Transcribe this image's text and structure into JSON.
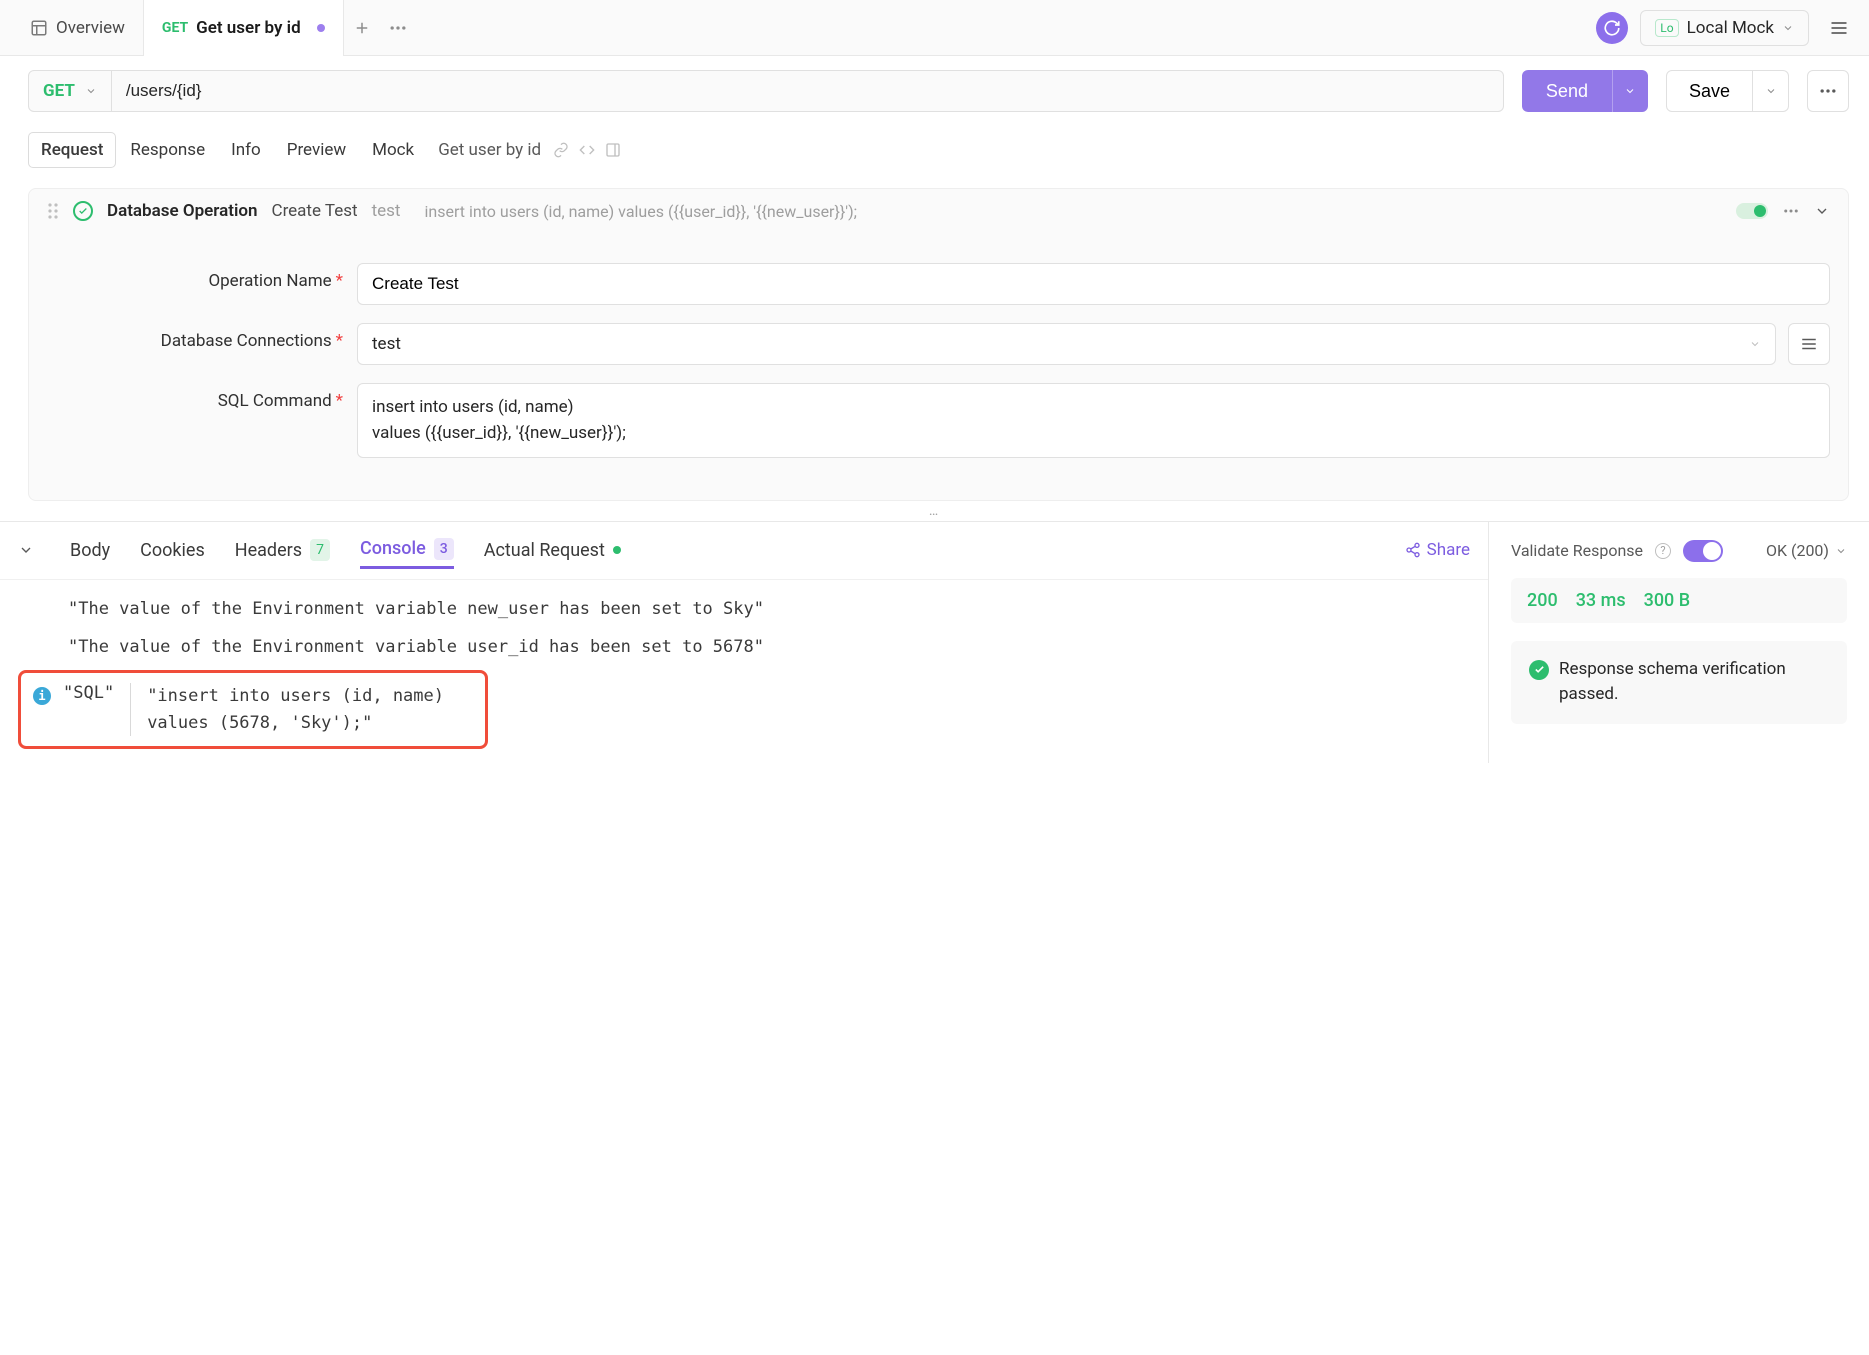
{
  "tabs": {
    "overview": "Overview",
    "active": {
      "method": "GET",
      "title": "Get user by id"
    }
  },
  "env": {
    "badge": "Lo",
    "name": "Local Mock"
  },
  "request": {
    "method": "GET",
    "url": "/users/{id}",
    "send": "Send",
    "save": "Save"
  },
  "subtabs": {
    "request": "Request",
    "response": "Response",
    "info": "Info",
    "preview": "Preview",
    "mock": "Mock",
    "breadcrumb": "Get user by id"
  },
  "operation": {
    "title": "Database Operation",
    "subtitle": "Create Test",
    "badge": "test",
    "preview_sql": "insert into users (id, name) values ({{user_id}}, '{{new_user}}');",
    "labels": {
      "name": "Operation Name",
      "conn": "Database Connections",
      "sql": "SQL Command"
    },
    "values": {
      "name": "Create Test",
      "conn": "test",
      "sql": "insert into users (id, name)\nvalues ({{user_id}}, '{{new_user}}');"
    }
  },
  "collapse_dots": "…",
  "response_tabs": {
    "body": "Body",
    "cookies": "Cookies",
    "headers": "Headers",
    "headers_count": "7",
    "console": "Console",
    "console_count": "3",
    "actual": "Actual Request",
    "share": "Share"
  },
  "console": {
    "line1": "\"The value of the Environment variable new_user has been set to Sky\"",
    "line2": "\"The value of the Environment variable user_id has been set to 5678\"",
    "sql_label": "\"SQL\"",
    "sql_body": "\"insert into users (id, name)\nvalues (5678, 'Sky');\""
  },
  "validate": {
    "label": "Validate Response",
    "status_select": "OK (200)",
    "stats": {
      "code": "200",
      "time": "33 ms",
      "size": "300 B"
    },
    "schema_msg": "Response schema verification passed."
  }
}
